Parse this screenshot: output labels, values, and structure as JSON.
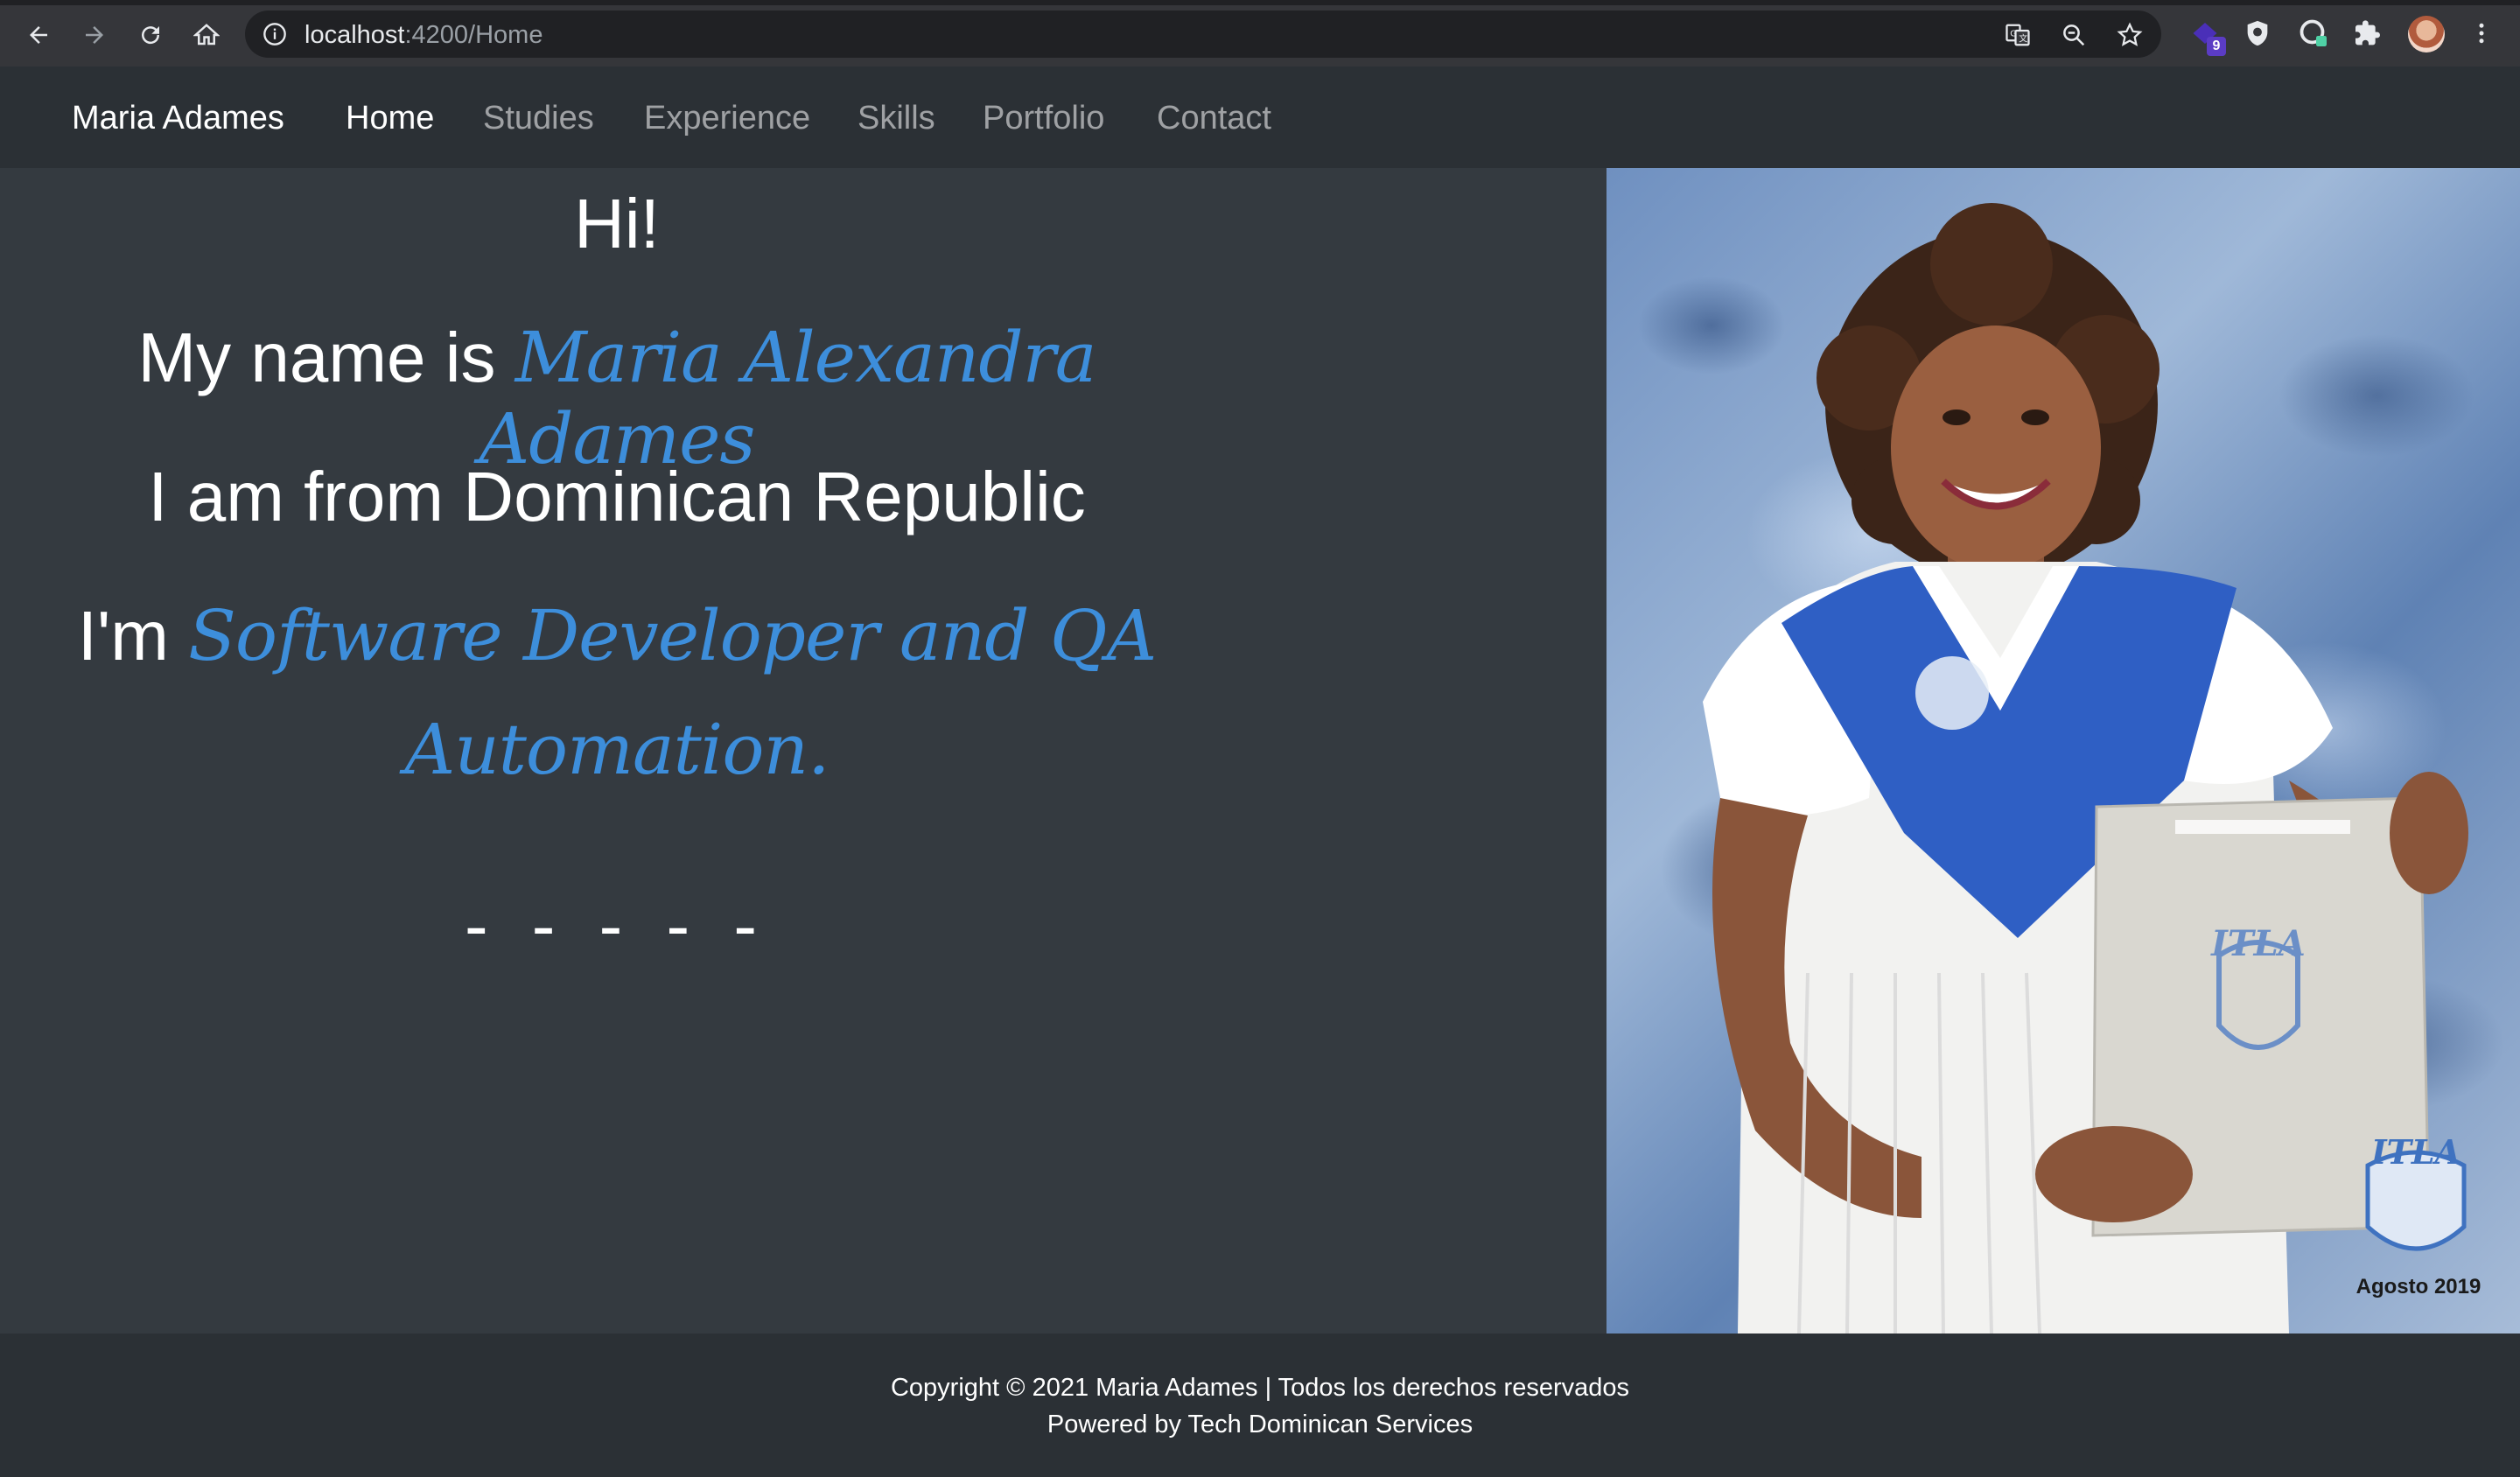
{
  "browser": {
    "url_host": "localhost",
    "url_path": ":4200/Home",
    "extension_badge": "9"
  },
  "navbar": {
    "brand": "Maria Adames",
    "links": [
      "Home",
      "Studies",
      "Experience",
      "Skills",
      "Portfolio",
      "Contact"
    ],
    "active": "Home"
  },
  "intro": {
    "greeting": "Hi!",
    "name_prefix": "My name is",
    "name": "Maria Alexandra Adames",
    "origin": "I am from Dominican Republic",
    "role_prefix": "I'm",
    "role_line1": "Software Developer and QA",
    "role_line2": "Automation.",
    "dashes": "- - - - -"
  },
  "photo": {
    "stamp_logo": "ITLA",
    "stamp_caption": "Agosto 2019",
    "folder_logo": "ITLA"
  },
  "footer": {
    "copyright": "Copyright © 2021 Maria Adames | Todos los derechos reservados",
    "powered": "Powered by Tech Dominican Services"
  },
  "colors": {
    "background": "#343a40",
    "navbar": "#2b3035",
    "accent": "#3d8edb",
    "text": "#ffffff"
  }
}
